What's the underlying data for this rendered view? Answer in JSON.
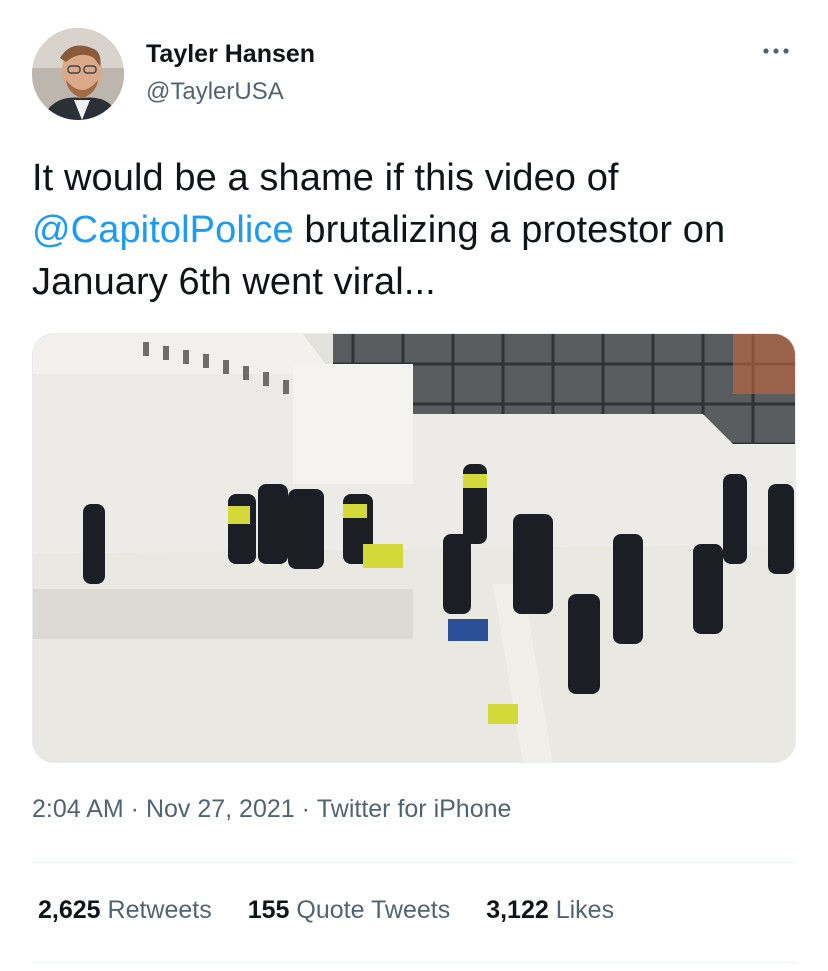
{
  "author": {
    "name": "Tayler Hansen",
    "handle": "@TaylerUSA"
  },
  "tweet": {
    "text_before": "It would be a shame if this video of ",
    "mention": "@CapitolPolice",
    "text_after": " brutalizing a protestor on January 6th went viral..."
  },
  "meta": {
    "time": "2:04 AM",
    "separator": " · ",
    "date": "Nov 27, 2021",
    "separator2": " · ",
    "source": "Twitter for iPhone"
  },
  "stats": {
    "retweets_count": "2,625",
    "retweets_label": " Retweets",
    "quotes_count": "155",
    "quotes_label": " Quote Tweets",
    "likes_count": "3,122",
    "likes_label": " Likes"
  },
  "colors": {
    "accent": "#1d9bf0",
    "secondary_text": "#536471",
    "primary_text": "#0f1419"
  }
}
